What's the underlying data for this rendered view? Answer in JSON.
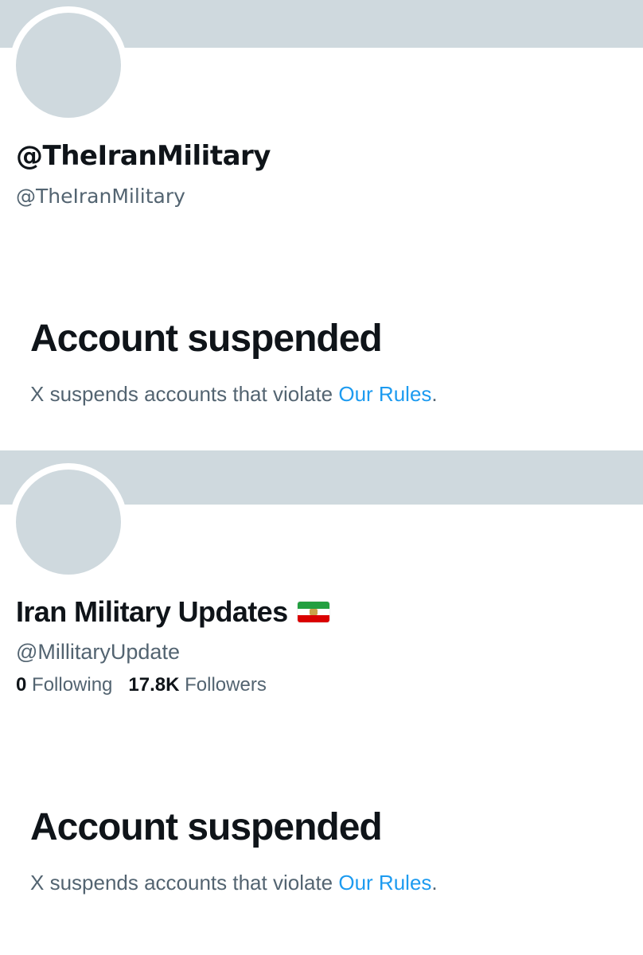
{
  "profiles": [
    {
      "display_name": "@TheIranMilitary",
      "handle": "@TheIranMilitary",
      "suspended_title": "Account suspended",
      "suspended_text": "X suspends accounts that violate ",
      "rules_link": "Our Rules",
      "suspended_suffix": "."
    },
    {
      "display_name": "Iran Military Updates",
      "flag_icon": "iran-flag-emoji",
      "handle": "@MillitaryUpdate",
      "following_count": "0",
      "following_label": " Following",
      "followers_count": "17.8K",
      "followers_label": " Followers",
      "suspended_title": "Account suspended",
      "suspended_text": "X suspends accounts that violate ",
      "rules_link": "Our Rules",
      "suspended_suffix": "."
    }
  ],
  "colors": {
    "banner": "#cfd9de",
    "avatar": "#cfd9de",
    "primary_text": "#0f1419",
    "secondary_text": "#536471",
    "link": "#1d9bf0"
  }
}
